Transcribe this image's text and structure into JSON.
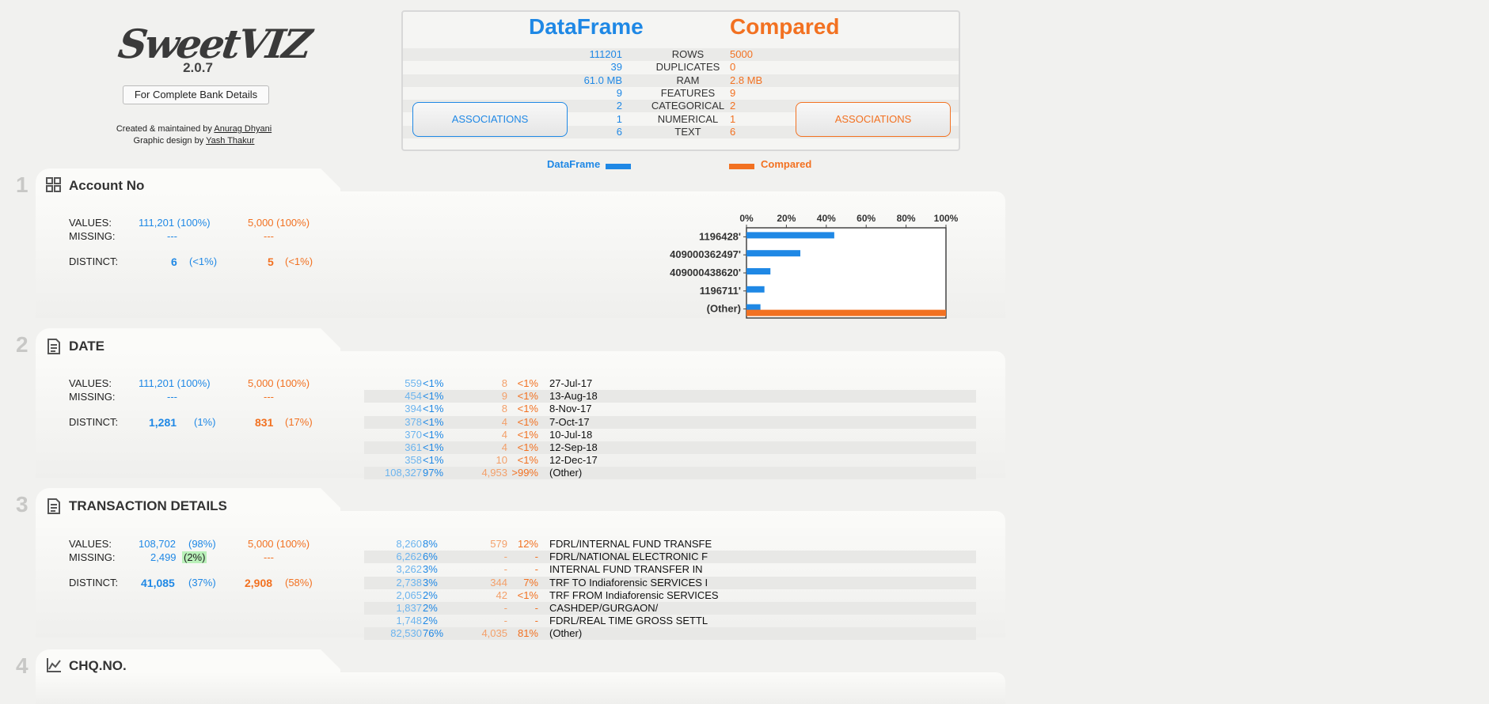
{
  "header": {
    "logo_text": "SweetVIZ",
    "version": "2.0.7",
    "report_name": "For Complete Bank Details",
    "credit1_prefix": "Created & maintained by ",
    "credit1_name": "Anurag Dhyani",
    "credit2_prefix": "Graphic design by ",
    "credit2_name": "Yash Thakur"
  },
  "summary": {
    "left_title": "DataFrame",
    "right_title": "Compared",
    "rows": [
      {
        "label": "ROWS",
        "left": "111201",
        "right": "5000"
      },
      {
        "label": "DUPLICATES",
        "left": "39",
        "right": "0"
      },
      {
        "label": "RAM",
        "left": "61.0 MB",
        "right": "2.8 MB"
      },
      {
        "label": "FEATURES",
        "left": "9",
        "right": "9"
      },
      {
        "label": "CATEGORICAL",
        "left": "2",
        "right": "2"
      },
      {
        "label": "NUMERICAL",
        "left": "1",
        "right": "1"
      },
      {
        "label": "TEXT",
        "left": "6",
        "right": "6"
      }
    ],
    "assoc_label": "ASSOCIATIONS",
    "legend_left": "DataFrame",
    "legend_right": "Compared",
    "colors": {
      "left": "#1f88e5",
      "right": "#f27121"
    }
  },
  "features": [
    {
      "num": "1",
      "name": "Account No",
      "icon": "categorical-grid-icon",
      "values_l": "111,201 (100%)",
      "values_r": "5,000 (100%)",
      "missing_l": "---",
      "missing_r": "---",
      "distinct_l": "6",
      "distinct_l_pct": "(<1%)",
      "distinct_r": "5",
      "distinct_r_pct": "(<1%)",
      "labels": {
        "values": "VALUES:",
        "missing": "MISSING:",
        "distinct": "DISTINCT:"
      }
    },
    {
      "num": "2",
      "name": "DATE",
      "icon": "text-document-icon",
      "values_l": "111,201 (100%)",
      "values_r": "5,000 (100%)",
      "missing_l": "---",
      "missing_r": "---",
      "distinct_l": "1,281",
      "distinct_l_pct": "(1%)",
      "distinct_r": "831",
      "distinct_r_pct": "(17%)",
      "labels": {
        "values": "VALUES:",
        "missing": "MISSING:",
        "distinct": "DISTINCT:"
      },
      "freq": [
        [
          "559",
          "<1%",
          "8",
          "<1%",
          "27-Jul-17"
        ],
        [
          "454",
          "<1%",
          "9",
          "<1%",
          "13-Aug-18"
        ],
        [
          "394",
          "<1%",
          "8",
          "<1%",
          "8-Nov-17"
        ],
        [
          "378",
          "<1%",
          "4",
          "<1%",
          "7-Oct-17"
        ],
        [
          "370",
          "<1%",
          "4",
          "<1%",
          "10-Jul-18"
        ],
        [
          "361",
          "<1%",
          "4",
          "<1%",
          "12-Sep-18"
        ],
        [
          "358",
          "<1%",
          "10",
          "<1%",
          "12-Dec-17"
        ],
        [
          "108,327",
          "97%",
          "4,953",
          ">99%",
          "(Other)"
        ]
      ]
    },
    {
      "num": "3",
      "name": "TRANSACTION DETAILS",
      "icon": "text-document-icon",
      "values_l": "108,702",
      "values_l_pct": "(98%)",
      "values_r": "5,000 (100%)",
      "missing_l": "2,499",
      "missing_l_pct": "(2%)",
      "missing_r": "---",
      "distinct_l": "41,085",
      "distinct_l_pct": "(37%)",
      "distinct_r": "2,908",
      "distinct_r_pct": "(58%)",
      "labels": {
        "values": "VALUES:",
        "missing": "MISSING:",
        "distinct": "DISTINCT:"
      },
      "freq": [
        [
          "8,260",
          "8%",
          "579",
          "12%",
          "FDRL/INTERNAL FUND TRANSFE"
        ],
        [
          "6,262",
          "6%",
          "-",
          "-",
          "FDRL/NATIONAL ELECTRONIC F"
        ],
        [
          "3,262",
          "3%",
          "-",
          "-",
          "INTERNAL FUND TRANSFER IN"
        ],
        [
          "2,738",
          "3%",
          "344",
          "7%",
          "TRF TO Indiaforensic SERVICES I"
        ],
        [
          "2,065",
          "2%",
          "42",
          "<1%",
          "TRF FROM Indiaforensic SERVICES"
        ],
        [
          "1,837",
          "2%",
          "-",
          "-",
          "CASHDEP/GURGAON/"
        ],
        [
          "1,748",
          "2%",
          "-",
          "-",
          "FDRL/REAL TIME GROSS SETTL"
        ],
        [
          "82,530",
          "76%",
          "4,035",
          "81%",
          "(Other)"
        ]
      ]
    },
    {
      "num": "4",
      "name": "CHQ.NO.",
      "icon": "numeric-line-chart-icon"
    }
  ],
  "chart_data": {
    "type": "bar",
    "orientation": "horizontal",
    "categories": [
      "1196428'",
      "409000362497'",
      "409000438620'",
      "1196711'",
      "(Other)"
    ],
    "series": [
      {
        "name": "DataFrame",
        "values": [
          44,
          27,
          12,
          9,
          7
        ]
      },
      {
        "name": "Compared",
        "values": [
          0,
          0,
          0,
          0,
          100
        ]
      }
    ],
    "xticks": [
      "0%",
      "20%",
      "40%",
      "60%",
      "80%",
      "100%"
    ],
    "xlim": [
      0,
      100
    ]
  }
}
